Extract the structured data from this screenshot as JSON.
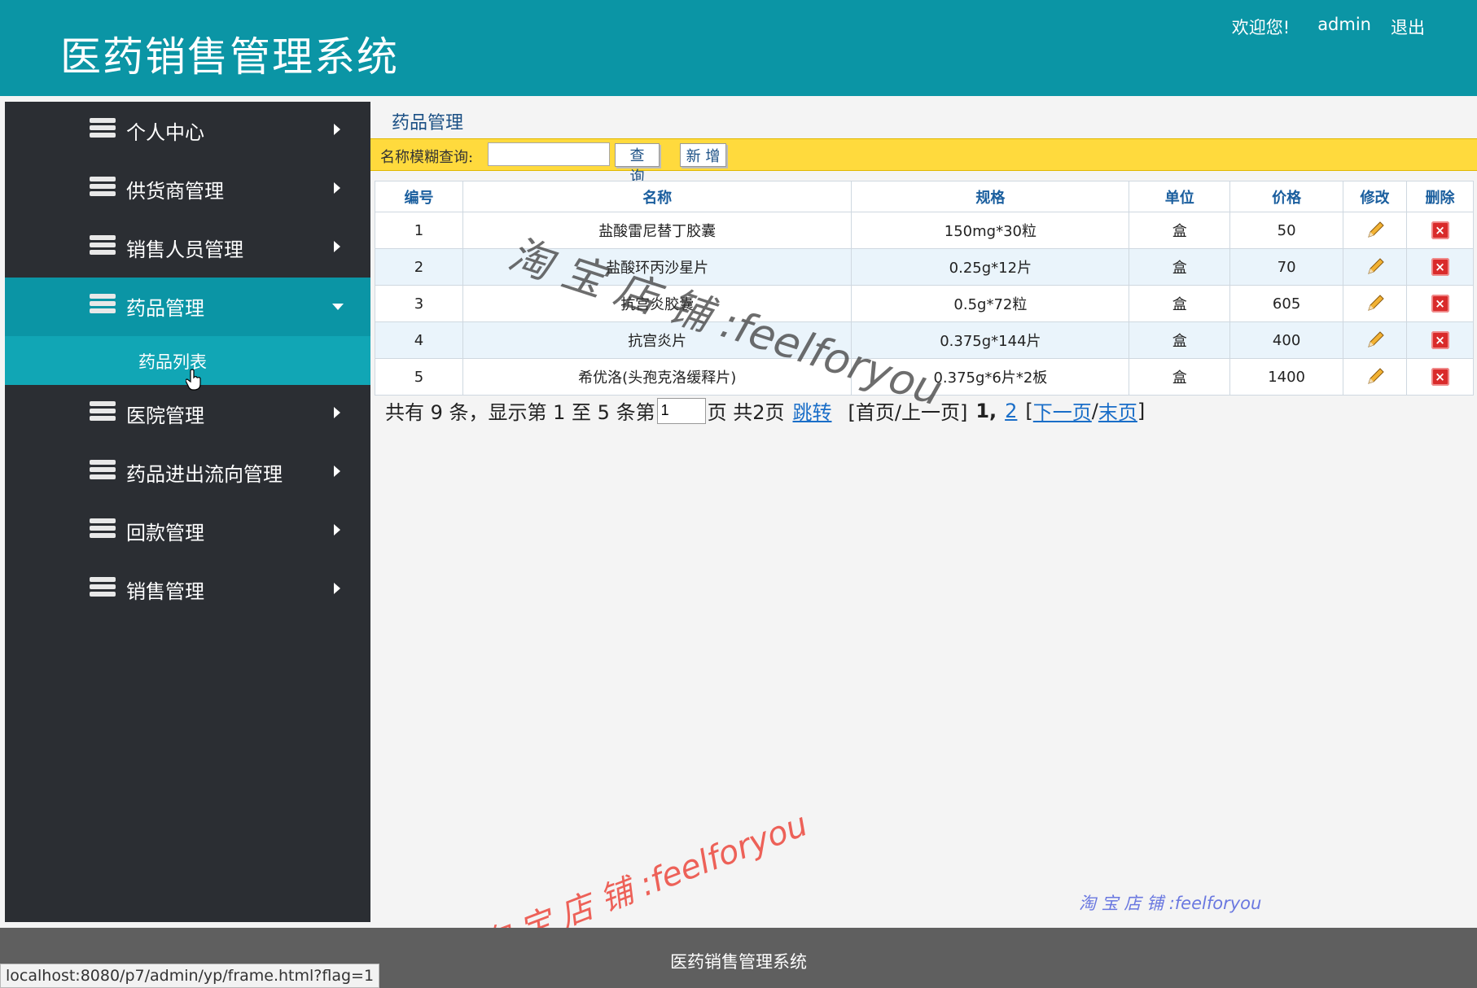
{
  "header": {
    "title": "医药销售管理系统",
    "welcome": "欢迎您!",
    "user": "admin",
    "logout": "退出"
  },
  "sidebar": {
    "items": [
      {
        "label": "个人中心"
      },
      {
        "label": "供货商管理"
      },
      {
        "label": "销售人员管理"
      },
      {
        "label": "药品管理"
      },
      {
        "label": "医院管理"
      },
      {
        "label": "药品进出流向管理"
      },
      {
        "label": "回款管理"
      },
      {
        "label": "销售管理"
      }
    ],
    "active_sub": "药品列表"
  },
  "content": {
    "title": "药品管理",
    "search_label": "名称模糊查询:",
    "search_value": "",
    "search_button": "查 询",
    "add_button": "新 增"
  },
  "table": {
    "headers": [
      "编号",
      "名称",
      "规格",
      "单位",
      "价格",
      "修改",
      "删除"
    ],
    "rows": [
      [
        "1",
        "盐酸雷尼替丁胶囊",
        "150mg*30粒",
        "盒",
        "50"
      ],
      [
        "2",
        "盐酸环丙沙星片",
        "0.25g*12片",
        "盒",
        "70"
      ],
      [
        "3",
        "抗宫炎胶囊",
        "0.5g*72粒",
        "盒",
        "605"
      ],
      [
        "4",
        "抗宫炎片",
        "0.375g*144片",
        "盒",
        "400"
      ],
      [
        "5",
        "希优洛(头孢克洛缓释片)",
        "0.375g*6片*2板",
        "盒",
        "1400"
      ]
    ],
    "edit_icon": "pencil-icon",
    "delete_icon": "delete-icon"
  },
  "pager": {
    "summary": "共有 9 条，显示第 1 至 5 条第",
    "page_input": "1",
    "total": "页 共2页",
    "jump": "跳转",
    "first_prev": "[首页/上一页]",
    "current": "1,",
    "page2": "2",
    "bracket_open": "[",
    "next": "下一页",
    "slash": "/",
    "last": "末页",
    "bracket_close": "]"
  },
  "watermarks": {
    "big": "淘 宝 店 铺 :feelforyou",
    "red": "淘 宝 店 铺 :feelforyou",
    "small": "淘 宝 店 铺 :feelforyou"
  },
  "footer": {
    "text": "医药销售管理系统"
  },
  "status_bar": {
    "url": "localhost:8080/p7/admin/yp/frame.html?flag=1"
  },
  "colors": {
    "header": "#0b95a5",
    "sidebar": "#2b2e33",
    "toolbar": "#ffda3d",
    "footer": "#5f5f5f"
  }
}
